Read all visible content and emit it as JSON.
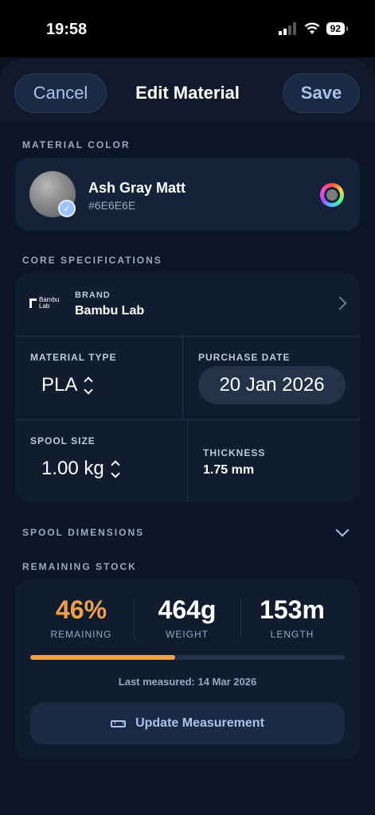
{
  "status_bar": {
    "time": "19:58",
    "battery": "92"
  },
  "header": {
    "cancel_label": "Cancel",
    "title": "Edit Material",
    "save_label": "Save"
  },
  "material_color": {
    "section_label": "MATERIAL COLOR",
    "name": "Ash Gray Matt",
    "hex": "#6E6E6E",
    "swatch_color": "#8D8D8D"
  },
  "core_specs": {
    "section_label": "CORE SPECIFICATIONS",
    "brand_label": "BRAND",
    "brand_value": "Bambu Lab",
    "brand_logo_text": "Bambu Lab",
    "material_type_label": "MATERIAL TYPE",
    "material_type_value": "PLA",
    "purchase_date_label": "PURCHASE DATE",
    "purchase_date_value": "20 Jan 2026",
    "spool_size_label": "SPOOL SIZE",
    "spool_size_value": "1.00 kg",
    "thickness_label": "THICKNESS",
    "thickness_value": "1.75 mm"
  },
  "spool_dimensions": {
    "section_label": "SPOOL DIMENSIONS"
  },
  "remaining_stock": {
    "section_label": "REMAINING STOCK",
    "remaining_value": "46%",
    "remaining_label": "REMAINING",
    "remaining_fraction": 0.46,
    "weight_value": "464g",
    "weight_label": "WEIGHT",
    "length_value": "153m",
    "length_label": "LENGTH",
    "last_measured": "Last measured: 14 Mar 2026",
    "update_button_label": "Update Measurement"
  },
  "colors": {
    "accent": "#A9C4EC",
    "remaining_highlight": "#F0A04B",
    "background": "#0D1626",
    "card": "#15233A"
  }
}
